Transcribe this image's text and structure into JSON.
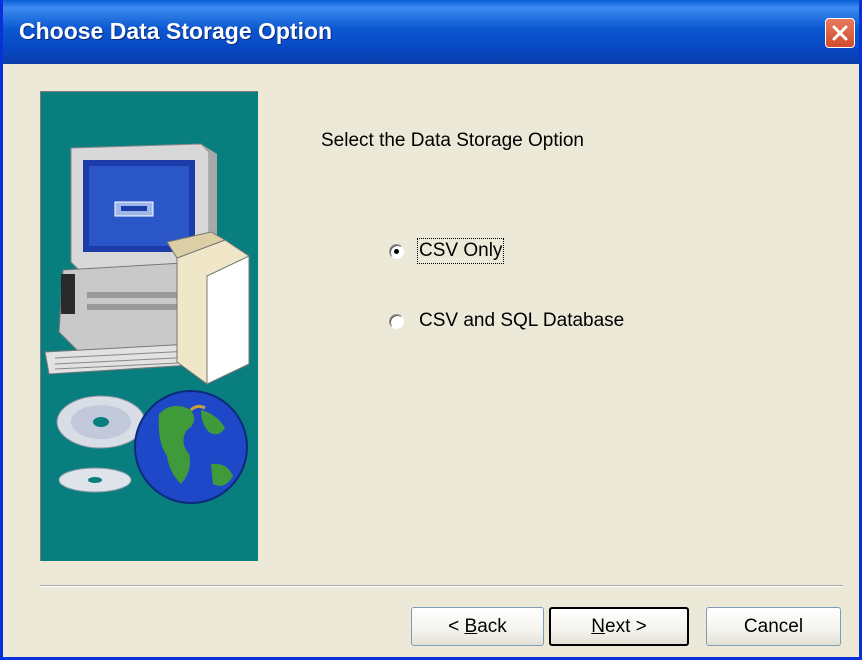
{
  "window": {
    "title": "Choose Data Storage Option"
  },
  "content": {
    "prompt": "Select the Data Storage Option",
    "options": [
      {
        "label": "CSV Only",
        "selected": true
      },
      {
        "label": "CSV and SQL Database",
        "selected": false
      }
    ]
  },
  "buttons": {
    "back_prefix": "< ",
    "back_hotkey": "B",
    "back_rest": "ack",
    "next_hotkey": "N",
    "next_rest": "ext >",
    "cancel": "Cancel"
  },
  "icons": [
    "close-icon",
    "computer-illustration",
    "cd-disc-icon",
    "globe-icon"
  ],
  "colors": {
    "titlebar": "#0b57d0",
    "dialog_bg": "#ece9d8",
    "side_panel": "#087e7e",
    "close_button": "#d14b2b"
  }
}
